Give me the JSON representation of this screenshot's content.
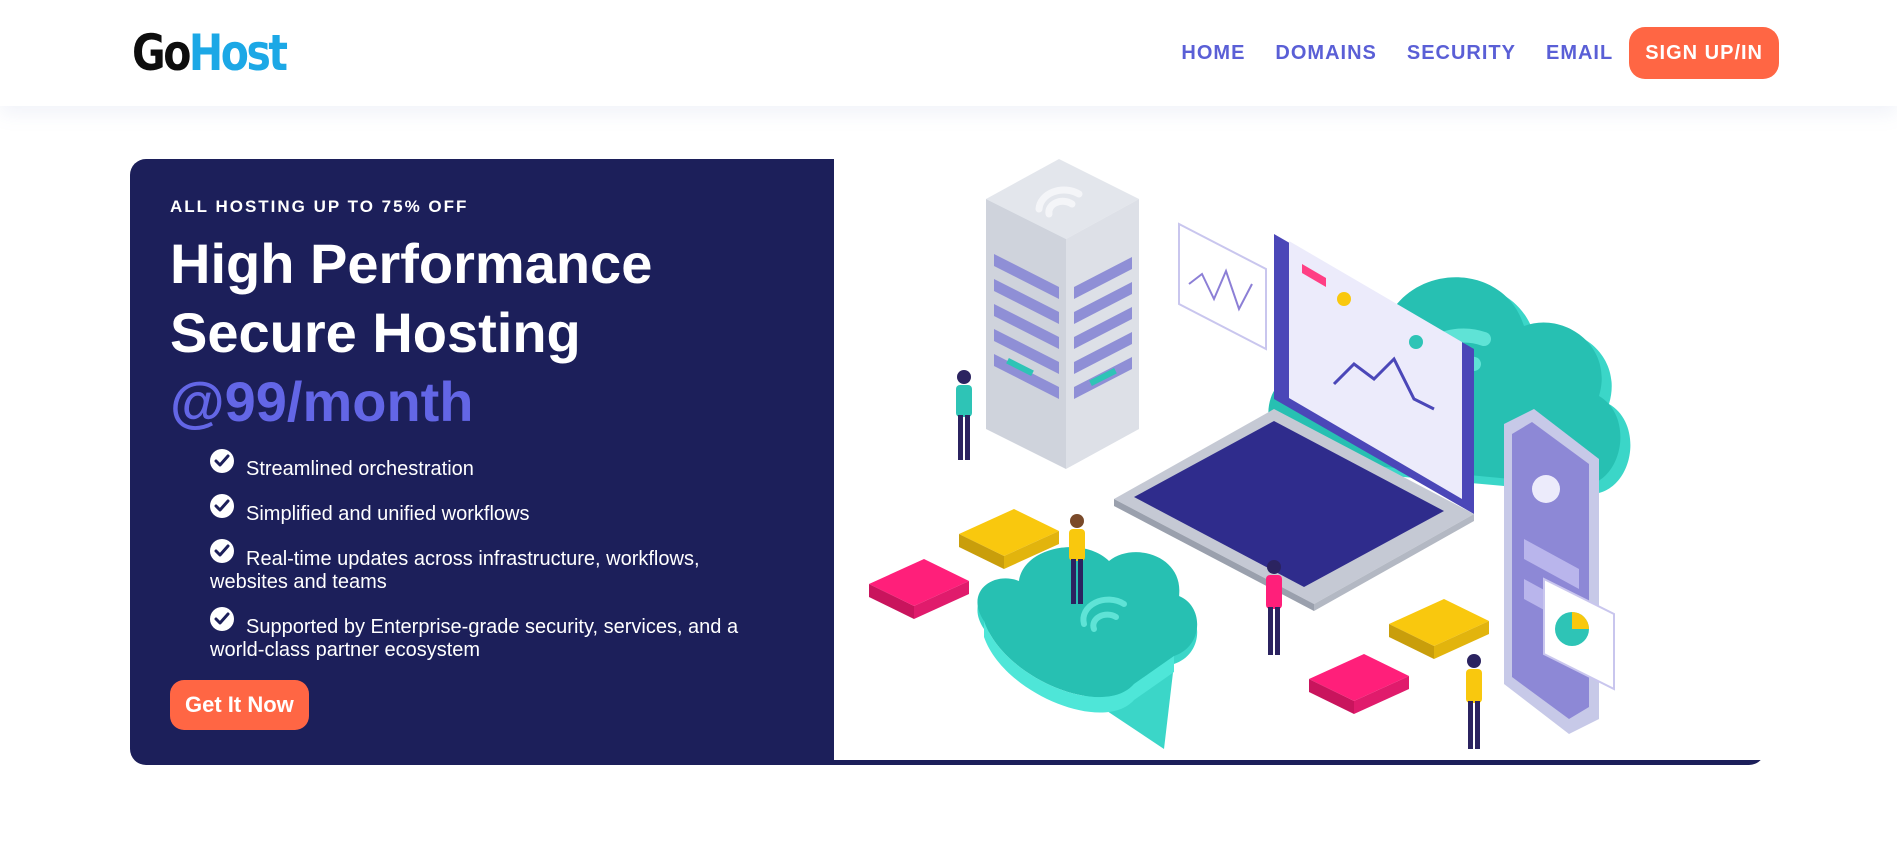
{
  "header": {
    "logo": {
      "part1": "Go",
      "part2": "Host"
    },
    "nav": [
      "HOME",
      "DOMAINS",
      "SECURITY",
      "EMAIL"
    ],
    "signup_label": "SIGN UP/IN"
  },
  "hero": {
    "eyebrow": "ALL HOSTING UP TO 75% OFF",
    "headline_line1": "High Performance",
    "headline_line2": "Secure Hosting",
    "price": "@99/month",
    "features": [
      "Streamlined orchestration",
      "Simplified and unified workflows",
      "Real-time updates across infrastructure, workflows, websites and teams",
      "Supported by Enterprise-grade security, services, and a world-class partner ecosystem"
    ],
    "cta_label": "Get It Now"
  },
  "colors": {
    "brand_dark": "#1c1f5a",
    "accent_orange": "#ff6644",
    "nav_purple": "#5a5fd6",
    "price_purple": "#6366e6",
    "logo_blue": "#1ca8e6",
    "cloud_teal": "#2ec4b6"
  },
  "icons": [
    "check-circle-icon",
    "wifi-icon",
    "server-rack-icon",
    "laptop-icon",
    "cloud-icon",
    "smartphone-icon",
    "folder-icon",
    "person-icon",
    "line-chart-icon",
    "pie-chart-icon"
  ]
}
